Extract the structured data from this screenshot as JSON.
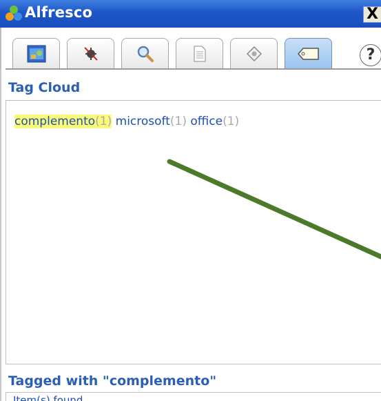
{
  "window": {
    "title": "Alfresco",
    "close_label": "X"
  },
  "tabs": [
    {
      "icon": "dashboard-icon",
      "active": false
    },
    {
      "icon": "bug-icon",
      "active": false
    },
    {
      "icon": "magnifier-icon",
      "active": false
    },
    {
      "icon": "document-icon",
      "active": false
    },
    {
      "icon": "workflow-icon",
      "active": false
    },
    {
      "icon": "tag-icon",
      "active": true
    }
  ],
  "help": {
    "label": "?"
  },
  "tag_cloud": {
    "title": "Tag Cloud",
    "tags": [
      {
        "name": "complemento",
        "count": "(1)",
        "highlighted": true
      },
      {
        "name": "microsoft",
        "count": "(1)",
        "highlighted": false
      },
      {
        "name": "office",
        "count": "(1)",
        "highlighted": false
      }
    ]
  },
  "tagged": {
    "title": "Tagged with \"complemento\"",
    "status": "Item(s) found"
  },
  "colors": {
    "title_bar": "#1d56c8",
    "accent_text": "#2b5fb3",
    "highlight": "#fafa7a",
    "arrow": "#4a7a2a"
  }
}
